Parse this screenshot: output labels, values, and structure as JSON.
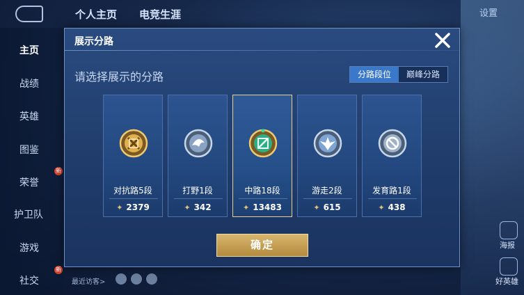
{
  "background": {
    "tabs": [
      "个人主页",
      "电竞生涯"
    ],
    "settings_label": "设置",
    "nav_items": [
      "主页",
      "战绩",
      "英雄",
      "图鉴",
      "荣誉",
      "护卫队",
      "游戏",
      "社交"
    ],
    "badges": {
      "honor": "新",
      "social": "新"
    },
    "visitors_label": "最近访客>",
    "right_labels": [
      "海报",
      "好英雄"
    ]
  },
  "modal": {
    "title": "展示分路",
    "subtitle": "请选择展示的分路",
    "toggle": {
      "options": [
        "分路段位",
        "巅峰分路"
      ],
      "selected": 0
    },
    "cards": [
      {
        "lane": "对抗路5段",
        "points": "2379",
        "emblem": "clash-lane-emblem",
        "color": "#d9a548"
      },
      {
        "lane": "打野1段",
        "points": "342",
        "emblem": "jungle-emblem",
        "color": "#9fb4cf"
      },
      {
        "lane": "中路18段",
        "points": "13483",
        "emblem": "mid-lane-emblem",
        "color": "#39b58d"
      },
      {
        "lane": "游走2段",
        "points": "615",
        "emblem": "roam-emblem",
        "color": "#8fb3de"
      },
      {
        "lane": "发育路1段",
        "points": "438",
        "emblem": "farm-lane-emblem",
        "color": "#a6b6c9"
      }
    ],
    "selected_card": 2,
    "confirm_label": "确定",
    "colors": {
      "accent_gold": "#e8cf8e",
      "toggle_active": "#3a78c9"
    }
  }
}
